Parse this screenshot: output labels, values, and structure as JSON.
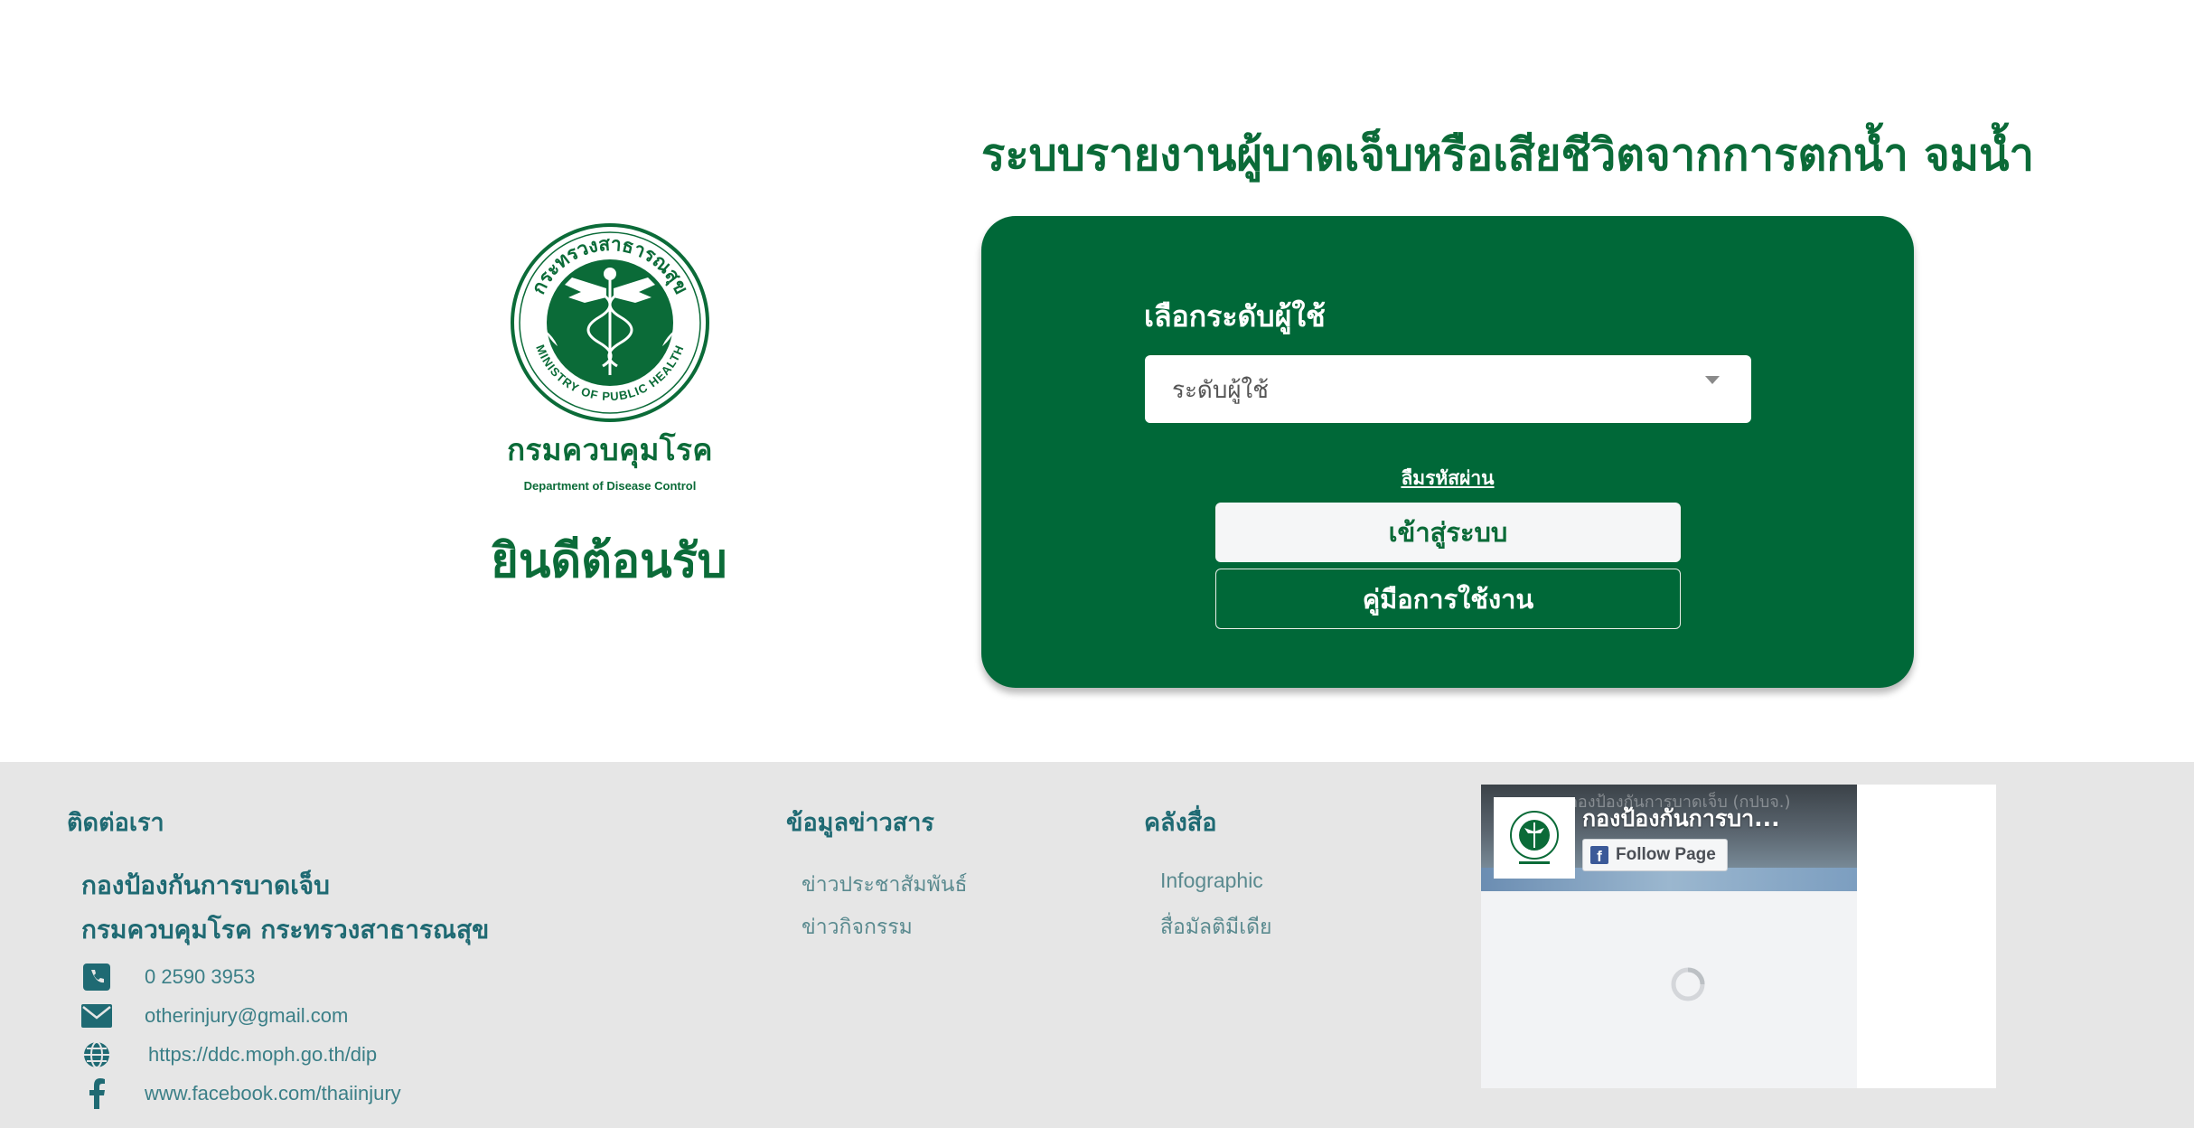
{
  "header": {
    "system_title": "ระบบรายงานผู้บาดเจ็บหรือเสียชีวิตจากการตกน้ำ จมน้ำ"
  },
  "branding": {
    "seal_ring_text_th": "กระทรวงสาธารณสุข",
    "seal_ring_text_en": "MINISTRY OF PUBLIC HEALTH",
    "department_th": "กรมควบคุมโรค",
    "department_en": "Department of Disease Control",
    "welcome": "ยินดีต้อนรับ",
    "brand_green": "#0b6b38",
    "card_green": "#006838"
  },
  "login": {
    "level_label": "เลือกระดับผู้ใช้",
    "level_select_value": "ระดับผู้ใช้",
    "forgot_password": "ลืมรหัสผ่าน",
    "login_button": "เข้าสู่ระบบ",
    "manual_button": "คู่มือการใช้งาน"
  },
  "footer": {
    "contact": {
      "heading": "ติดต่อเรา",
      "org_line1": "กองป้องกันการบาดเจ็บ",
      "org_line2": "กรมควบคุมโรค กระทรวงสาธารณสุข",
      "items": [
        {
          "icon": "phone-icon",
          "text": "0 2590 3953"
        },
        {
          "icon": "envelope-icon",
          "text": "otherinjury@gmail.com"
        },
        {
          "icon": "globe-icon",
          "text": "https://ddc.moph.go.th/dip"
        },
        {
          "icon": "facebook-icon",
          "text": "www.facebook.com/thaiinjury"
        }
      ]
    },
    "news": {
      "heading": "ข้อมูลข่าวสาร",
      "links": [
        "ข่าวประชาสัมพันธ์",
        "ข่าวกิจกรรม"
      ]
    },
    "media": {
      "heading": "คลังสื่อ",
      "links": [
        "Infographic",
        "สื่อมัลติมีเดีย"
      ]
    },
    "facebook_widget": {
      "page_name": "กองป้องกันการบา...",
      "cover_text": "กองป้องกันการบาดเจ็บ (กปบจ.)",
      "follow_label": "Follow Page"
    }
  }
}
